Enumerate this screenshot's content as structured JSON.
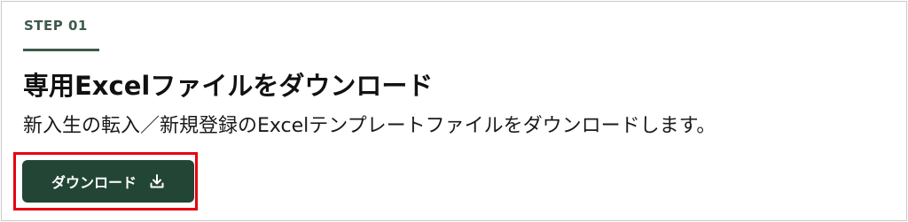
{
  "step": {
    "label": "STEP 01"
  },
  "card": {
    "title": "専用Excelファイルをダウンロード",
    "description": "新入生の転入／新規登録のExcelテンプレートファイルをダウンロードします。"
  },
  "download_button": {
    "label": "ダウンロード",
    "icon": "download-icon"
  },
  "colors": {
    "accent": "#234536",
    "step_text": "#3e5a4a",
    "highlight": "#e60012",
    "border": "#c9c9c9"
  }
}
